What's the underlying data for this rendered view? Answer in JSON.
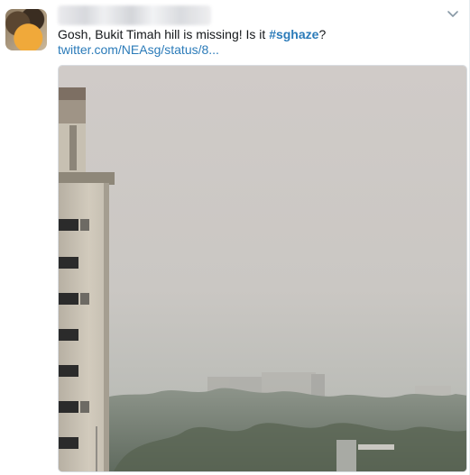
{
  "tweet": {
    "author": {
      "avatar_icon": "user-avatar-photo",
      "name_obscured": true
    },
    "text_prefix": "Gosh, Bukit Timah hill is missing! Is it ",
    "hashtag": "#sghaze",
    "text_suffix": "?",
    "link": "twitter.com/NEAsg/status/8...",
    "menu_icon": "chevron-down-icon",
    "media": {
      "description_icon": "haze-photo",
      "colors": {
        "sky": "#cfcac6",
        "haze_low": "#b9bbb6",
        "trees": "#7c8578",
        "building": "#cbc4b6",
        "windows": "#2a2a2a"
      }
    }
  },
  "colors": {
    "link": "#2b7bb9",
    "text": "#14171a",
    "muted": "#8899a6"
  }
}
